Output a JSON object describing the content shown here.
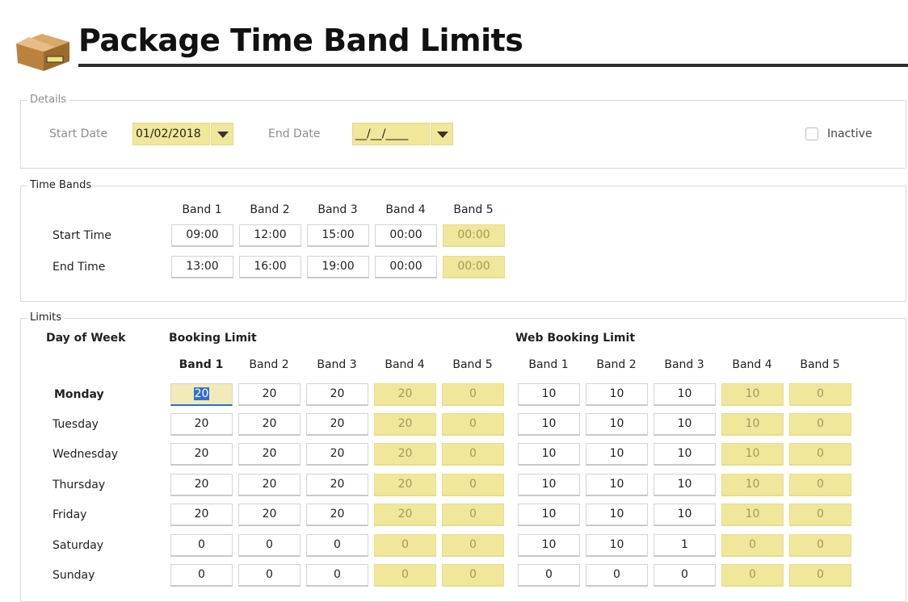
{
  "header": {
    "title": "Package Time Band Limits",
    "icon": "package-box-icon"
  },
  "details": {
    "legend": "Details",
    "start_date_label": "Start Date",
    "start_date_value": "01/02/2018",
    "end_date_label": "End Date",
    "end_date_value": "__/__/____",
    "inactive_label": "Inactive",
    "inactive_checked": false
  },
  "time_bands": {
    "legend": "Time Bands",
    "band_headers": [
      "Band 1",
      "Band 2",
      "Band 3",
      "Band 4",
      "Band 5"
    ],
    "start_time_label": "Start Time",
    "end_time_label": "End Time",
    "start_times": [
      "09:00",
      "12:00",
      "15:00",
      "00:00",
      "00:00"
    ],
    "end_times": [
      "13:00",
      "16:00",
      "19:00",
      "00:00",
      "00:00"
    ]
  },
  "limits": {
    "legend": "Limits",
    "day_of_week_label": "Day of Week",
    "booking_limit_label": "Booking Limit",
    "web_booking_limit_label": "Web Booking Limit",
    "booking_band_headers": [
      "Band 1",
      "Band 2",
      "Band 3",
      "Band 4",
      "Band 5"
    ],
    "web_band_headers": [
      "Band 1",
      "Band 2",
      "Band 3",
      "Band 4",
      "Band 5"
    ],
    "days": [
      {
        "day": "Monday",
        "booking": [
          "20",
          "20",
          "20",
          "20",
          "0"
        ],
        "web": [
          "10",
          "10",
          "10",
          "10",
          "0"
        ]
      },
      {
        "day": "Tuesday",
        "booking": [
          "20",
          "20",
          "20",
          "20",
          "0"
        ],
        "web": [
          "10",
          "10",
          "10",
          "10",
          "0"
        ]
      },
      {
        "day": "Wednesday",
        "booking": [
          "20",
          "20",
          "20",
          "20",
          "0"
        ],
        "web": [
          "10",
          "10",
          "10",
          "10",
          "0"
        ]
      },
      {
        "day": "Thursday",
        "booking": [
          "20",
          "20",
          "20",
          "20",
          "0"
        ],
        "web": [
          "10",
          "10",
          "10",
          "10",
          "0"
        ]
      },
      {
        "day": "Friday",
        "booking": [
          "20",
          "20",
          "20",
          "20",
          "0"
        ],
        "web": [
          "10",
          "10",
          "10",
          "10",
          "0"
        ]
      },
      {
        "day": "Saturday",
        "booking": [
          "0",
          "0",
          "0",
          "0",
          "0"
        ],
        "web": [
          "10",
          "10",
          "1",
          "0",
          "0"
        ]
      },
      {
        "day": "Sunday",
        "booking": [
          "0",
          "0",
          "0",
          "0",
          "0"
        ],
        "web": [
          "0",
          "0",
          "0",
          "0",
          "0"
        ]
      }
    ]
  },
  "colors": {
    "disabled_field": "#f0e79b",
    "header_rule": "#2b2b2b",
    "selection": "#2f6fd6"
  }
}
